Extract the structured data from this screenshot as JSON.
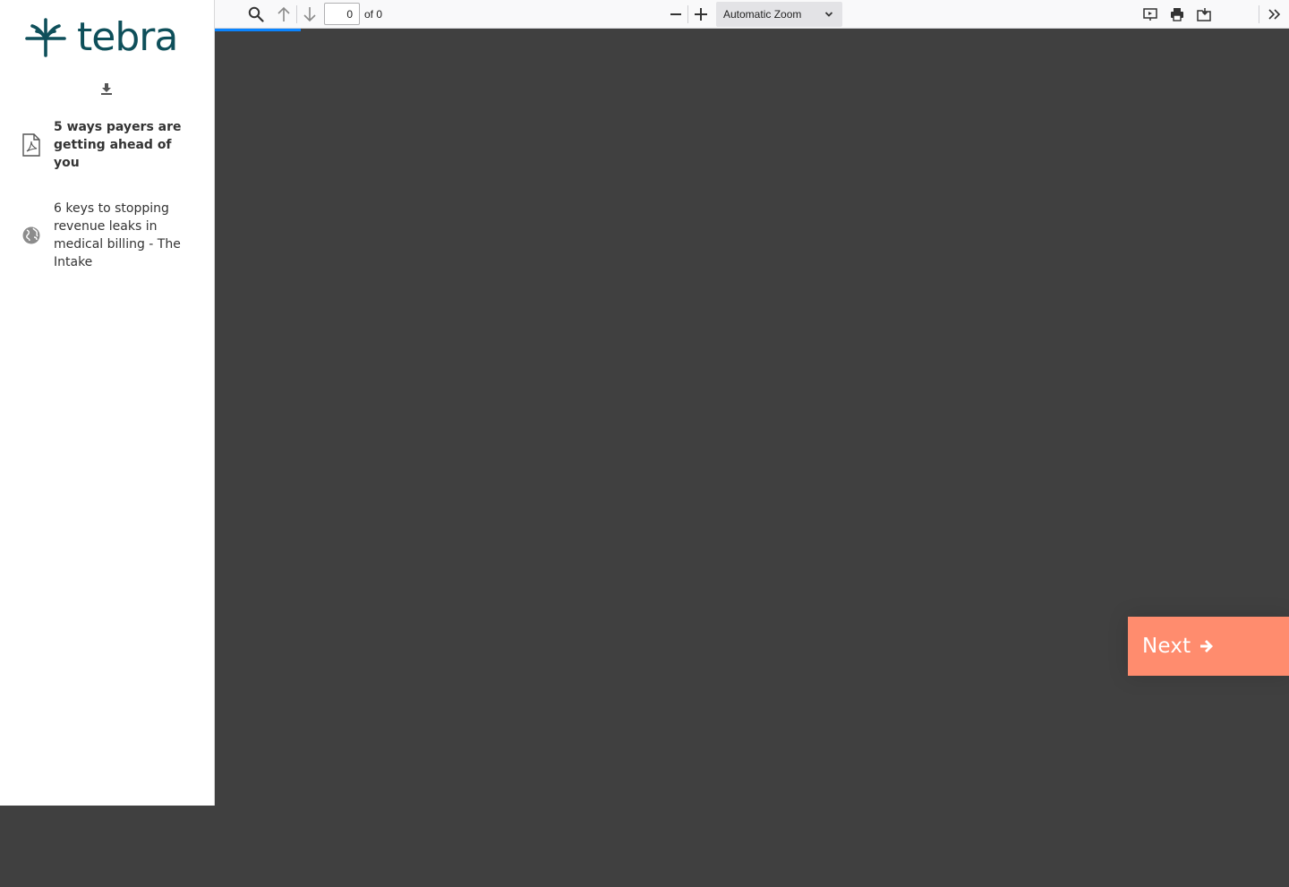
{
  "brand": {
    "name": "tebra",
    "color": "#0e4f5a",
    "accent": "#ff8c6e"
  },
  "sidebar": {
    "download_icon": "download-icon",
    "documents": [
      {
        "label": "5 ways payers are getting ahead of you",
        "icon": "pdf-icon",
        "active": true
      },
      {
        "label": "6 keys to stopping revenue leaks in medical billing - The Intake",
        "icon": "globe-icon",
        "active": false
      }
    ]
  },
  "toolbar": {
    "page_value": "0",
    "page_count": "of 0",
    "zoom": {
      "selected": "Automatic Zoom"
    },
    "icons": [
      "search-icon",
      "arrow-up-icon",
      "arrow-down-icon",
      "zoom-out-icon",
      "zoom-in-icon",
      "presentation-icon",
      "print-icon",
      "save-icon",
      "tools-chevron-icon"
    ]
  },
  "next": {
    "label": "Next"
  }
}
